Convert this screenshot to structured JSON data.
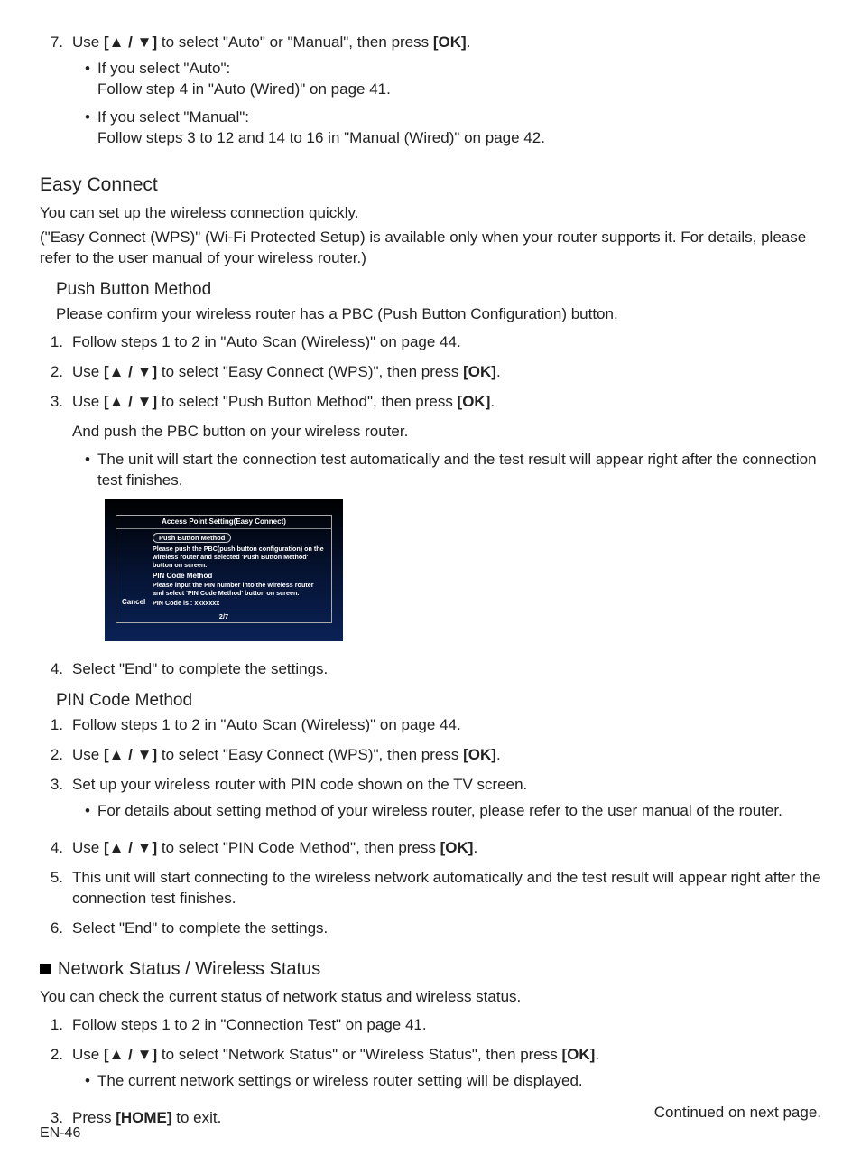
{
  "top_list": {
    "num": "7.",
    "line1_a": "Use ",
    "line1_keys": "[▲ / ▼]",
    "line1_b": " to select \"Auto\" or \"Manual\", then press ",
    "line1_ok": "[OK]",
    "line1_c": ".",
    "bullets": [
      {
        "head": "If you select \"Auto\":",
        "body": "Follow step 4 in \"Auto (Wired)\" on page 41."
      },
      {
        "head": "If you select \"Manual\":",
        "body": "Follow steps  3 to 12 and 14 to 16 in \"Manual (Wired)\" on page 42."
      }
    ]
  },
  "easy_connect": {
    "title": "Easy Connect",
    "p1": "You can set up the wireless connection quickly.",
    "p2": "(\"Easy Connect (WPS)\" (Wi-Fi Protected Setup) is available only when your router supports it. For details, please refer to the user manual of your wireless router.)"
  },
  "push_button": {
    "title": "Push Button Method",
    "intro": "Please confirm your wireless router has a PBC (Push Button Configuration) button.",
    "steps": [
      {
        "n": "1.",
        "text": "Follow steps 1 to 2 in \"Auto Scan (Wireless)\" on page 44."
      },
      {
        "n": "2.",
        "a": "Use ",
        "keys": "[▲ / ▼]",
        "b": " to select \"Easy Connect (WPS)\", then press ",
        "ok": "[OK]",
        "c": "."
      },
      {
        "n": "3.",
        "a": "Use ",
        "keys": "[▲ / ▼]",
        "b": " to select \"Push Button Method\", then press ",
        "ok": "[OK]",
        "c": ".",
        "after": "And push the PBC button  on your wireless router.",
        "bullet": "The unit will start the connection test automatically and the test result will appear right after the connection test finishes."
      },
      {
        "n": "4.",
        "text": "Select \"End\" to complete the settings."
      }
    ]
  },
  "dialog": {
    "title": "Access Point Setting(Easy Connect)",
    "pb_label": "Push Button Method",
    "pb_text": "Please push the PBC(push button configuration) on the wireless router and selected 'Push Button Method' button on screen.",
    "pin_label": "PIN Code Method",
    "pin_text": "Please input the PIN number into the wireless router and select 'PIN Code Method' button on screen.",
    "pin_code_line": "PIN Code is :    xxxxxxx",
    "cancel": "Cancel",
    "page": "2/7"
  },
  "pin_code": {
    "title": "PIN Code Method",
    "steps": [
      {
        "n": "1.",
        "text": "Follow steps 1 to 2 in \"Auto Scan (Wireless)\" on page 44."
      },
      {
        "n": "2.",
        "a": "Use ",
        "keys": "[▲ / ▼]",
        "b": " to select \"Easy Connect (WPS)\", then press ",
        "ok": "[OK]",
        "c": "."
      },
      {
        "n": "3.",
        "text": "Set up your wireless router with PIN code shown on the TV screen.",
        "bullet": "For details about setting method of your wireless router, please refer to the user manual of the router."
      },
      {
        "n": "4.",
        "a": "Use ",
        "keys": "[▲ / ▼]",
        "b": " to select \"PIN Code Method\", then press ",
        "ok": "[OK]",
        "c": "."
      },
      {
        "n": "5.",
        "text": "This unit will start connecting to the wireless network automatically and the test result will appear right after the connection test finishes."
      },
      {
        "n": "6.",
        "text": "Select \"End\" to complete the settings."
      }
    ]
  },
  "network_status": {
    "title": "Network Status / Wireless Status",
    "intro": "You can check the current status of network status and wireless status.",
    "steps": [
      {
        "n": "1.",
        "text": "Follow steps 1 to 2 in \"Connection Test\" on page 41."
      },
      {
        "n": "2.",
        "a": "Use ",
        "keys": "[▲ / ▼]",
        "b": " to select \"Network Status\" or \"Wireless Status\", then press ",
        "ok": "[OK]",
        "c": ".",
        "bullet": "The current network settings or wireless router setting will be displayed."
      },
      {
        "n": "3.",
        "a": "Press ",
        "keys": "[HOME]",
        "b": " to exit."
      }
    ]
  },
  "footer": {
    "right": "Continued on next page.",
    "left": "EN-46"
  }
}
